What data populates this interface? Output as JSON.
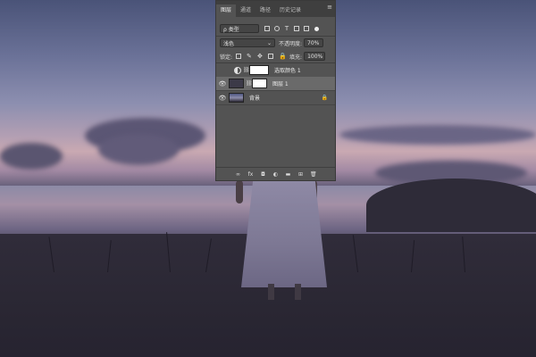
{
  "panel": {
    "tabs": [
      {
        "label": "图层",
        "active": true
      },
      {
        "label": "通道",
        "active": false
      },
      {
        "label": "路径",
        "active": false
      },
      {
        "label": "历史记录",
        "active": false
      }
    ],
    "menu_icon": "panel-menu-icon",
    "filter": {
      "kind_label": "ρ 类型"
    },
    "blend": {
      "mode": "浅色",
      "opacity_label": "不透明度:",
      "opacity_value": "70%"
    },
    "lock": {
      "label": "锁定:",
      "fill_label": "填充:",
      "fill_value": "100%"
    },
    "layers": [
      {
        "name": "选取颜色 1",
        "visible": false,
        "type": "adjustment",
        "selected": false
      },
      {
        "name": "图层 1",
        "visible": true,
        "type": "pixel",
        "selected": true
      },
      {
        "name": "背景",
        "visible": true,
        "type": "background",
        "selected": false,
        "locked": true
      }
    ],
    "footer_buttons": [
      {
        "name": "link-layers-icon",
        "glyph": "∞"
      },
      {
        "name": "fx-icon",
        "glyph": "fx"
      },
      {
        "name": "add-mask-icon",
        "glyph": "◘"
      },
      {
        "name": "adjustment-layer-icon",
        "glyph": "◐"
      },
      {
        "name": "group-folder-icon",
        "glyph": "▬"
      },
      {
        "name": "new-layer-icon",
        "glyph": "⊞"
      },
      {
        "name": "delete-layer-icon",
        "glyph": "🗑"
      }
    ],
    "colors": {
      "panel_bg": "#535353",
      "tabbar_bg": "#3f3f3f",
      "selected_row": "#6a6a6a"
    }
  }
}
